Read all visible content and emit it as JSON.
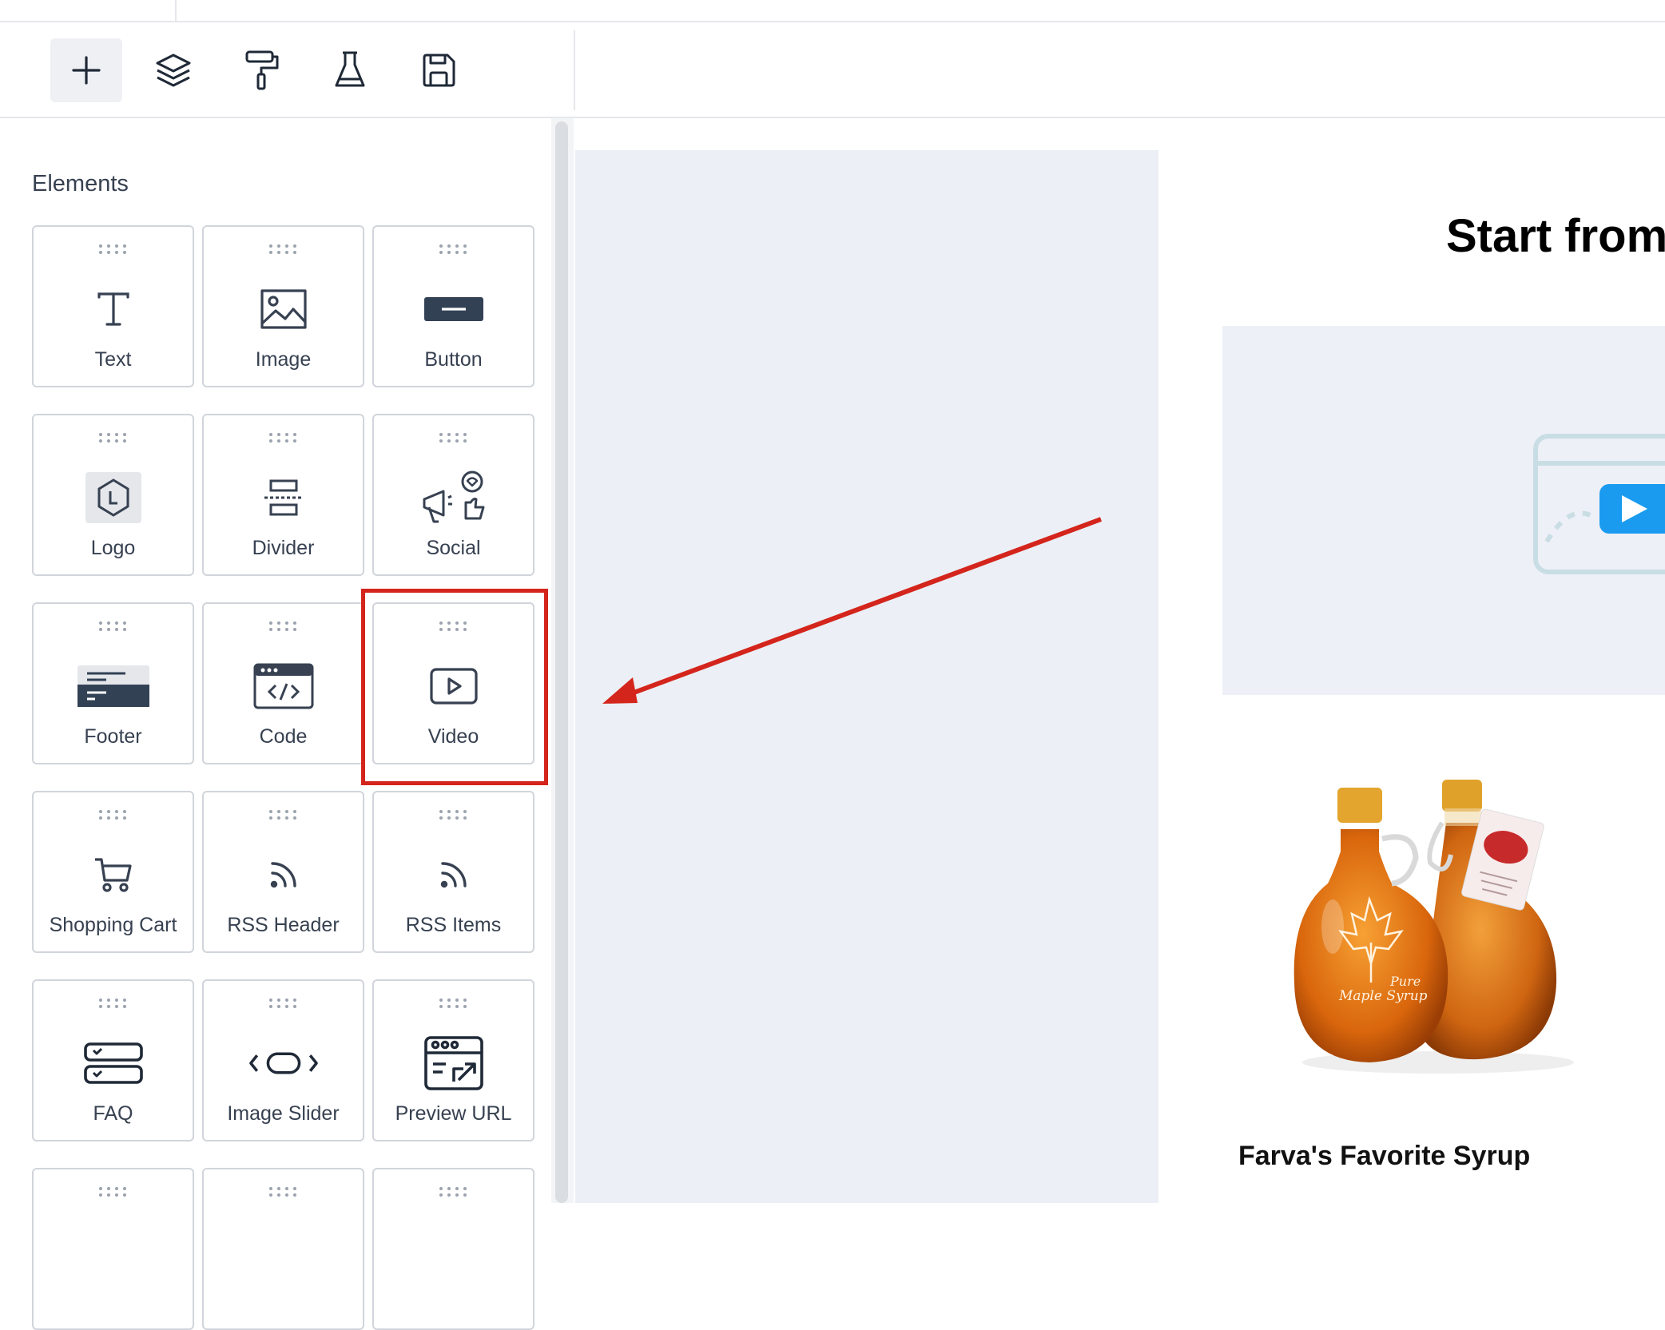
{
  "sidebar": {
    "title": "Elements",
    "elements": [
      {
        "label": "Text",
        "icon": "text-icon"
      },
      {
        "label": "Image",
        "icon": "image-icon"
      },
      {
        "label": "Button",
        "icon": "button-icon"
      },
      {
        "label": "Logo",
        "icon": "logo-icon"
      },
      {
        "label": "Divider",
        "icon": "divider-icon"
      },
      {
        "label": "Social",
        "icon": "social-icon"
      },
      {
        "label": "Footer",
        "icon": "footer-icon"
      },
      {
        "label": "Code",
        "icon": "code-icon"
      },
      {
        "label": "Video",
        "icon": "video-icon"
      },
      {
        "label": "Shopping Cart",
        "icon": "cart-icon"
      },
      {
        "label": "RSS Header",
        "icon": "rss-icon"
      },
      {
        "label": "RSS Items",
        "icon": "rss-icon"
      },
      {
        "label": "FAQ",
        "icon": "faq-icon"
      },
      {
        "label": "Image Slider",
        "icon": "slider-icon"
      },
      {
        "label": "Preview URL",
        "icon": "preview-url-icon"
      }
    ]
  },
  "toolbar": {
    "tools": [
      "add-icon",
      "layers-icon",
      "paint-roller-icon",
      "flask-icon",
      "save-icon"
    ]
  },
  "canvas": {
    "heading": "Start from",
    "product_title": "Farva's Favorite Syrup",
    "bottle_label_line1": "Pure",
    "bottle_label_line2": "Maple Syrup"
  },
  "annotation": {
    "color": "#d4251c",
    "highlighted_element": "Video"
  }
}
